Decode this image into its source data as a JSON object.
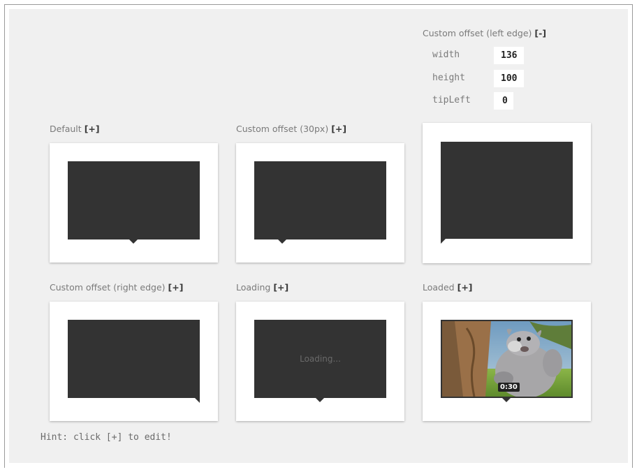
{
  "editor": {
    "title": "Custom offset (left edge)",
    "toggle": "[-]",
    "fields": [
      {
        "key": "width",
        "value": "136"
      },
      {
        "key": "height",
        "value": "100"
      },
      {
        "key": "tipLeft",
        "value": "0"
      }
    ]
  },
  "cards": [
    {
      "label": "Default",
      "toggle": "[+]"
    },
    {
      "label": "Custom offset (30px)",
      "toggle": "[+]"
    },
    {
      "label": "Custom offset (right edge)",
      "toggle": "[+]"
    },
    {
      "label": "Loading",
      "toggle": "[+]",
      "screen_text": "Loading..."
    },
    {
      "label": "Loaded",
      "toggle": "[+]",
      "duration": "0:30"
    }
  ],
  "hint": "Hint: click [+] to edit!",
  "colors": {
    "background": "#f0f0f0",
    "card": "#ffffff",
    "screen": "#333333"
  }
}
